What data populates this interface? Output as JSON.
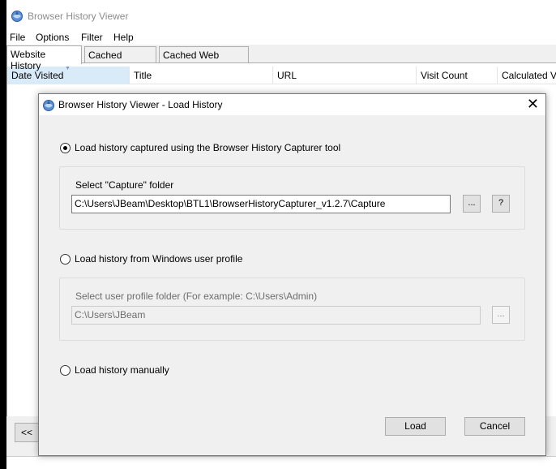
{
  "app": {
    "title": "Browser History Viewer",
    "icon": "browser-history-icon"
  },
  "menu": {
    "items": [
      "File",
      "Options",
      "Filter",
      "Help"
    ]
  },
  "tabs": [
    "Website History",
    "Cached Images",
    "Cached Web Pages"
  ],
  "table": {
    "columns": [
      "Date Visited",
      "Title",
      "URL",
      "Visit Count",
      "Calculated Vi"
    ]
  },
  "nav": {
    "prev_label": "<<"
  },
  "dialog": {
    "title": "Browser History Viewer - Load History",
    "close_glyph": "✕",
    "option1": {
      "label": "Load history captured using the Browser History Capturer tool",
      "checked": true,
      "group_label": "Select \"Capture\" folder",
      "path": "C:\\Users\\JBeam\\Desktop\\BTL1\\BrowserHistoryCapturer_v1.2.7\\Capture",
      "browse_label": "...",
      "help_label": "?"
    },
    "option2": {
      "label": "Load history from Windows user profile",
      "checked": false,
      "group_label": "Select user profile folder (For example: C:\\Users\\Admin)",
      "path": "C:\\Users\\JBeam",
      "browse_label": "..."
    },
    "option3": {
      "label": "Load history manually",
      "checked": false
    },
    "load_label": "Load",
    "cancel_label": "Cancel"
  }
}
